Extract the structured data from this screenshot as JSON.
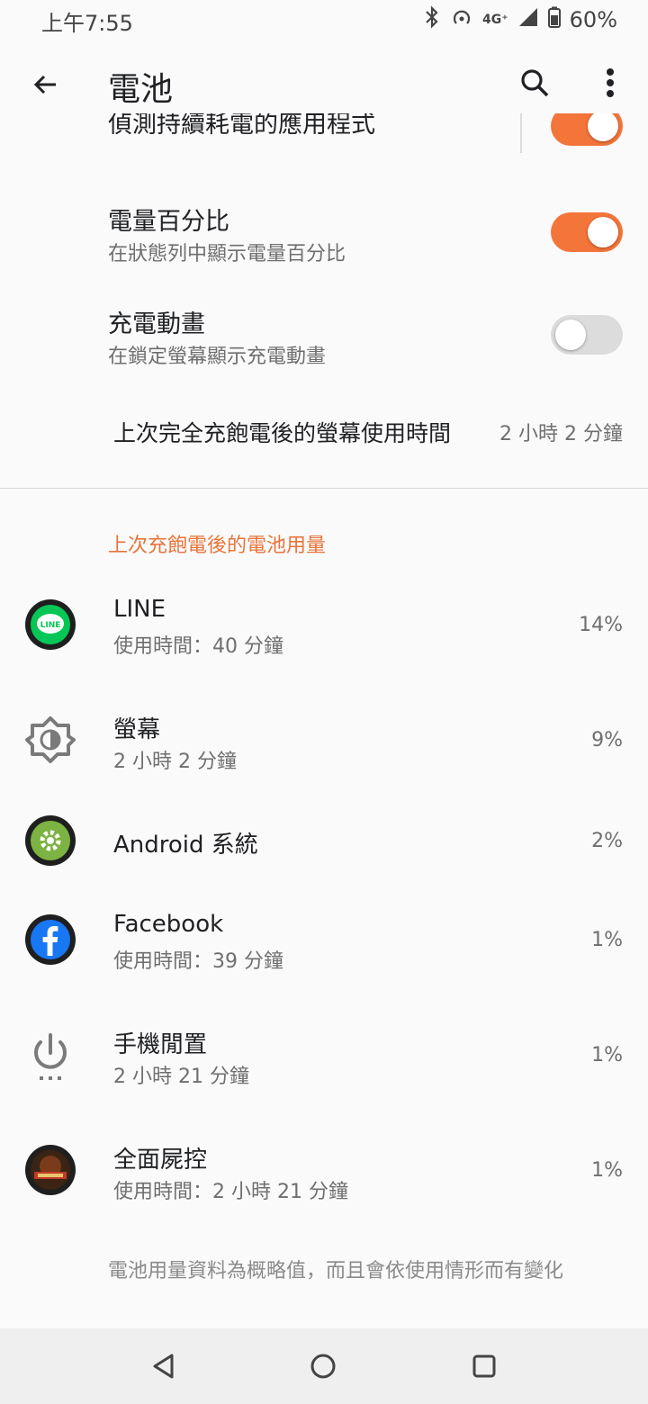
{
  "status_bar": {
    "time": "上午7:55",
    "network": "4G⁺",
    "battery": "60%"
  },
  "toolbar": {
    "title": "電池"
  },
  "settings": {
    "partial_item_title": "偵測持續耗電的應用程式",
    "battery_percentage": {
      "title": "電量百分比",
      "subtitle": "在狀態列中顯示電量百分比",
      "on": true
    },
    "charging_animation": {
      "title": "充電動畫",
      "subtitle": "在鎖定螢幕顯示充電動畫",
      "on": false
    },
    "screen_usage": {
      "label": "上次完全充飽電後的螢幕使用時間",
      "value": "2 小時 2 分鐘"
    }
  },
  "usage_section": {
    "header": "上次充飽電後的電池用量",
    "apps": [
      {
        "name": "LINE",
        "time": "使用時間：40 分鐘",
        "percent": "14%",
        "icon": "line-icon"
      },
      {
        "name": "螢幕",
        "time": "2 小時 2 分鐘",
        "percent": "9%",
        "icon": "brightness-icon"
      },
      {
        "name": "Android 系統",
        "time": "",
        "percent": "2%",
        "icon": "android-system-icon"
      },
      {
        "name": "Facebook",
        "time": "使用時間：39 分鐘",
        "percent": "1%",
        "icon": "facebook-icon"
      },
      {
        "name": "手機閒置",
        "time": "2 小時 21 分鐘",
        "percent": "1%",
        "icon": "power-icon"
      },
      {
        "name": "全面屍控",
        "time": "使用時間：2 小時 21 分鐘",
        "percent": "1%",
        "icon": "game-icon"
      }
    ],
    "footer_note": "電池用量資料為概略值，而且會依使用情形而有變化"
  },
  "colors": {
    "accent": "#f4753a",
    "section_header": "#e8743b",
    "background": "#fafafa"
  }
}
